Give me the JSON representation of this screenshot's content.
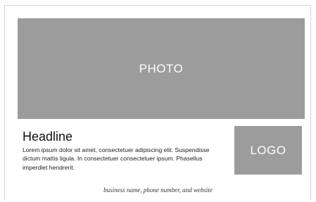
{
  "photo": {
    "label": "PHOTO"
  },
  "content": {
    "headline": "Headline",
    "body": "Lorem ipsum dolor sit amet, consectetuer adipiscing elit. Suspendisse dictum mattis ligula. In consectetuer consectetuer ipsum. Phasellus imperdiet hendrerit."
  },
  "logo": {
    "label": "LOGO"
  },
  "footer": {
    "text": "business name, phone number, and website"
  },
  "colors": {
    "placeholder_gray": "#9c9c9c",
    "placeholder_text": "#ffffff",
    "border": "#d4d4d4"
  }
}
